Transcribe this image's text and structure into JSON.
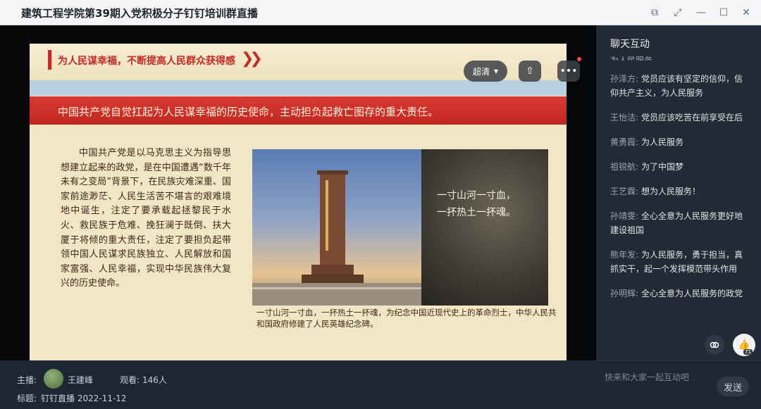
{
  "window": {
    "title": "建筑工程学院第39期入党积极分子钉钉培训群直播",
    "buttons": {
      "pip": "⧉",
      "fullscreen": "⤢",
      "minimize": "—",
      "maximize": "☐",
      "close": "✕"
    }
  },
  "player": {
    "quality_label": "超清",
    "quality_caret": "▾",
    "share_glyph": "⇧",
    "more_glyph": "•••"
  },
  "slide": {
    "heading": "为人民谋幸福，不断提高人民群众获得感",
    "heading_chevrons": "❯❯",
    "banner": "中国共产党自觉扛起为人民谋幸福的历史使命，主动担负起救亡图存的重大责任。",
    "body": "中国共产党是以马克思主义为指导思想建立起来的政党，是在中国遭遇“数千年未有之变局”背景下，在民族灾难深重、国家前途渺茫、人民生活苦不堪言的艰难境地中诞生，注定了要承载起拯黎民于水火、救民族于危难、挽狂澜于既倒、扶大厦于将倾的重大责任，注定了要担负起带领中国人民谋求民族独立、人民解放和国家富强、人民幸福，实现中华民族伟大复兴的历史使命。",
    "poem_line1": "一寸山河一寸血，",
    "poem_line2": "一抔热土一抔魂。",
    "caption": "一寸山河一寸血，一抔热土一抔魂，为纪念中国近现代史上的革命烈士，中华人民共和国政府修建了人民英雄纪念碑。"
  },
  "info": {
    "host_label": "主播:",
    "host_name": "王建峰",
    "viewers_label": "观看:",
    "viewers": "146人",
    "subject_label": "标题:",
    "subject": "钉钉直播 2022-11-12"
  },
  "chat": {
    "title": "聊天互动",
    "cut_line": "为人民服务",
    "messages": [
      {
        "who": "孙泽方:",
        "text": "党员应该有坚定的信仰，信仰共产主义，为人民服务"
      },
      {
        "who": "王怡洁:",
        "text": "党员应该吃苦在前享受在后"
      },
      {
        "who": "黄勇霞:",
        "text": "为人民服务"
      },
      {
        "who": "祖锐航:",
        "text": "为了中国梦"
      },
      {
        "who": "王艺霖:",
        "text": "想为人民服务！"
      },
      {
        "who": "孙靖雯:",
        "text": "全心全意为人民服务更好地建设祖国"
      },
      {
        "who": "熊年发:",
        "text": "为人民服务，勇于担当，真抓实干，起一个发挥模范带头作用"
      },
      {
        "who": "孙明辉:",
        "text": "全心全意为人民服务的政党"
      }
    ],
    "like_count": "71",
    "input_placeholder": "快来和大家一起互动吧",
    "send_label": "发送"
  }
}
